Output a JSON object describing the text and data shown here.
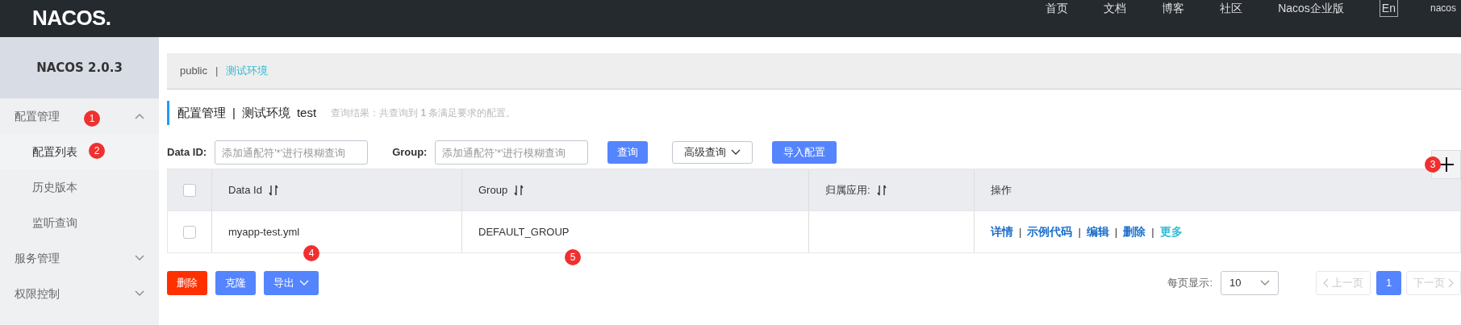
{
  "header": {
    "logo": "NACOS.",
    "nav": [
      "首页",
      "文档",
      "博客",
      "社区",
      "Nacos企业版"
    ],
    "language": "En",
    "user": "nacos"
  },
  "sidebar": {
    "title": "NACOS 2.0.3",
    "items": [
      {
        "label": "配置管理",
        "expanded": true,
        "children": [
          {
            "label": "配置列表",
            "selected": true
          },
          {
            "label": "历史版本",
            "selected": false
          },
          {
            "label": "监听查询",
            "selected": false
          }
        ]
      },
      {
        "label": "服务管理",
        "expanded": false
      },
      {
        "label": "权限控制",
        "expanded": false
      }
    ]
  },
  "namespaces": [
    {
      "kind": "link",
      "label": "public",
      "selected": false
    },
    {
      "kind": "separator",
      "label": "|"
    },
    {
      "kind": "link",
      "label": "测试环境",
      "selected": true
    }
  ],
  "page_title": {
    "title": "配置管理",
    "separator": "|",
    "namespace": "测试环境",
    "namespace_id": "test",
    "result": "查询结果：共查询到 **1** 条满足要求的配置。"
  },
  "search": {
    "fields": [
      {
        "label": "Data ID:",
        "placeholder": "添加通配符'*'进行模糊查询"
      },
      {
        "label": "Group:",
        "placeholder": "添加通配符'*'进行模糊查询"
      }
    ],
    "query_button": "查询",
    "advanced_button": "高级查询",
    "import_button": "导入配置"
  },
  "table": {
    "columns": [
      {
        "label": "Data Id",
        "sortable": true
      },
      {
        "label": "Group",
        "sortable": true
      },
      {
        "label": "归属应用:",
        "sortable": true
      },
      {
        "label": "操作",
        "sortable": false
      }
    ],
    "header_checked": false,
    "rows": [
      {
        "checked": false,
        "data_id": "myapp-test.yml",
        "group": "DEFAULT_GROUP",
        "actions": [
          {
            "kind": "link",
            "label": "详情",
            "color": "#1a6ecb"
          },
          {
            "kind": "separator",
            "label": "|"
          },
          {
            "kind": "link",
            "label": "示例代码",
            "color": "#1a6ecb"
          },
          {
            "kind": "separator",
            "label": "|"
          },
          {
            "kind": "link",
            "label": "编辑",
            "color": "#1a6ecb"
          },
          {
            "kind": "separator",
            "label": "|"
          },
          {
            "kind": "link",
            "label": "删除",
            "color": "#1a6ecb"
          },
          {
            "kind": "separator",
            "label": "|"
          },
          {
            "kind": "link",
            "label": "更多",
            "color": "#33bbd6"
          }
        ]
      }
    ]
  },
  "bulk_buttons": [
    {
      "label": "删除",
      "kind": "danger"
    },
    {
      "label": "克隆",
      "kind": "primary"
    },
    {
      "label": "导出",
      "kind": "dropdown"
    }
  ],
  "pagination": {
    "page_size_label": "每页显示:",
    "page_size": "10",
    "prev": "上一页",
    "pages": [
      {
        "label": "1",
        "selected": true
      }
    ],
    "next": "下一页"
  },
  "annotations": [
    "1",
    "2",
    "3",
    "4",
    "5"
  ]
}
